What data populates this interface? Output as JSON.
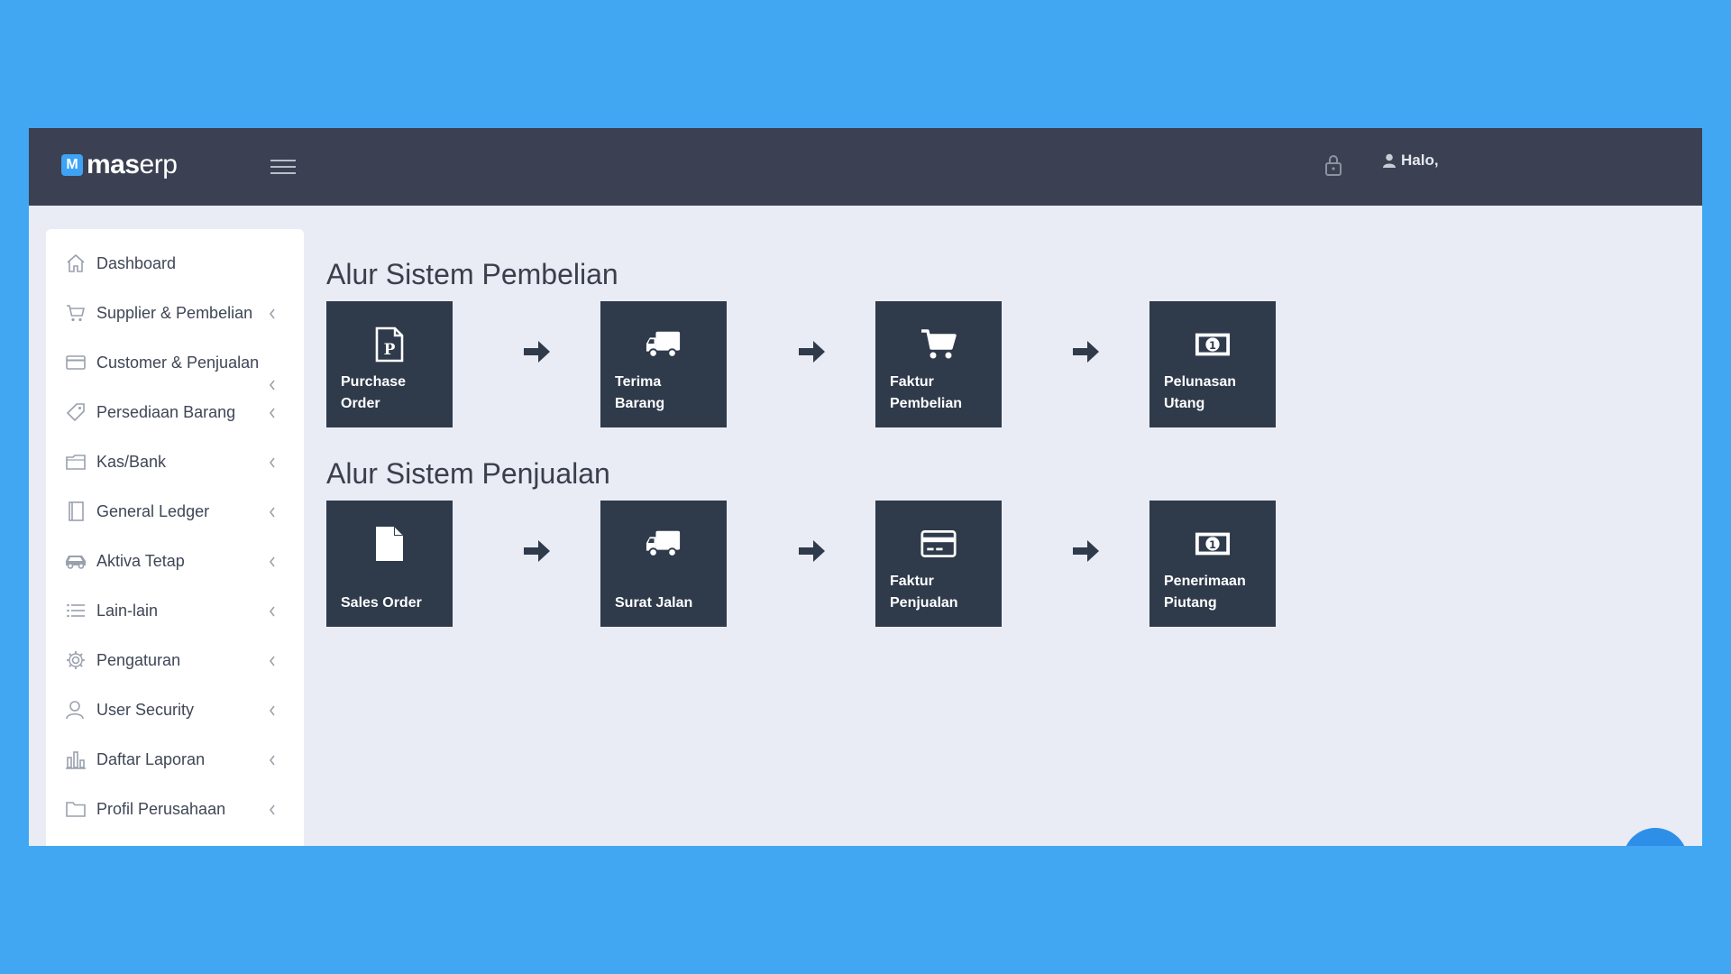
{
  "header": {
    "logo_badge": "M",
    "logo_bold": "mas",
    "logo_light": "erp",
    "user_greeting": "Halo,"
  },
  "sidebar": {
    "items": [
      {
        "label": "Dashboard",
        "icon": "home-icon"
      },
      {
        "label": "Supplier & Pembelian",
        "icon": "cart-icon"
      },
      {
        "label": "Customer & Penjualan",
        "icon": "credit-card-icon"
      },
      {
        "label": "Persediaan Barang",
        "icon": "tag-icon"
      },
      {
        "label": "Kas/Bank",
        "icon": "wallet-icon"
      },
      {
        "label": "General Ledger",
        "icon": "book-icon"
      },
      {
        "label": "Aktiva Tetap",
        "icon": "car-icon"
      },
      {
        "label": "Lain-lain",
        "icon": "list-icon"
      },
      {
        "label": "Pengaturan",
        "icon": "gear-icon"
      },
      {
        "label": "User Security",
        "icon": "user-icon"
      },
      {
        "label": "Daftar Laporan",
        "icon": "bar-chart-icon"
      },
      {
        "label": "Profil Perusahaan",
        "icon": "folder-icon"
      }
    ]
  },
  "purchase_flow": {
    "title": "Alur Sistem Pembelian",
    "steps": [
      {
        "label": "Purchase\nOrder",
        "icon": "document-p-icon"
      },
      {
        "label": "Terima\nBarang",
        "icon": "truck-icon"
      },
      {
        "label": "Faktur\nPembelian",
        "icon": "shopping-cart-icon"
      },
      {
        "label": "Pelunasan\nUtang",
        "icon": "money-icon"
      }
    ]
  },
  "sales_flow": {
    "title": "Alur Sistem Penjualan",
    "steps": [
      {
        "label": "Sales Order",
        "icon": "file-icon"
      },
      {
        "label": "Surat Jalan",
        "icon": "truck-icon"
      },
      {
        "label": "Faktur\nPenjualan",
        "icon": "credit-card-icon"
      },
      {
        "label": "Penerimaan\nPiutang",
        "icon": "money-icon"
      }
    ]
  },
  "colors": {
    "page_bg": "#42a7f3",
    "topbar": "#3b4052",
    "tile": "#2f3a4b",
    "content_bg": "#e9ecf4"
  }
}
